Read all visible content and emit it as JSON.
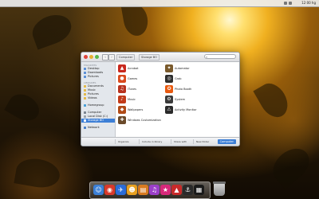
{
  "menubar": {
    "clock": "12:00 hg"
  },
  "window": {
    "nav": {
      "back": "‹",
      "forward": "›"
    },
    "breadcrumb": [
      "Computer",
      "Storage BO"
    ],
    "search": {
      "placeholder": "",
      "icon": "search-icon"
    }
  },
  "sidebar": {
    "sections": [
      {
        "heading": "Favorites",
        "items": [
          "Desktop",
          "Downloads",
          "Pictures"
        ]
      },
      {
        "heading": "Libraries",
        "items": [
          "Documents",
          "Music",
          "Pictures",
          "Videos"
        ]
      },
      {
        "heading": "",
        "items": [
          "Homegroup"
        ]
      },
      {
        "heading": "",
        "items": [
          "Computer",
          "Local Disk (C:)",
          "Storage BO"
        ]
      },
      {
        "heading": "",
        "items": [
          "Network"
        ]
      }
    ],
    "selected": "Storage BO"
  },
  "items": [
    {
      "label": "Acrobat",
      "color": "#c8281e",
      "glyph": "▲"
    },
    {
      "label": "Automator",
      "color": "#7a5a2c",
      "glyph": "✦"
    },
    {
      "label": "Games",
      "color": "#d94a1e",
      "glyph": "●"
    },
    {
      "label": "Grab",
      "color": "#2d2d2d",
      "glyph": "◎"
    },
    {
      "label": "iTunes",
      "color": "#b8321e",
      "glyph": "♫"
    },
    {
      "label": "Photo Booth",
      "color": "#e85a10",
      "glyph": "✪"
    },
    {
      "label": "Music",
      "color": "#c23a18",
      "glyph": "♪"
    },
    {
      "label": "System",
      "color": "#3a3a3a",
      "glyph": "⚙"
    },
    {
      "label": "Wallpapers",
      "color": "#b04a16",
      "glyph": "◆"
    },
    {
      "label": "Activity Monitor",
      "color": "#2a2a2a",
      "glyph": "⚠"
    },
    {
      "label": "Windows Customization",
      "color": "#6a4a2a",
      "glyph": "✚"
    }
  ],
  "bottombar": {
    "buttons": [
      "Organize",
      "Include in library",
      "Share with",
      "New folder"
    ],
    "selected_label": "Computer"
  },
  "dock": {
    "icons": [
      {
        "name": "finder-icon",
        "color": "#3b7fd6",
        "glyph": "☺"
      },
      {
        "name": "chrome-icon",
        "color": "#d8392b",
        "glyph": "◉"
      },
      {
        "name": "maps-icon",
        "color": "#2b6cd8",
        "glyph": "✈"
      },
      {
        "name": "smiley-icon",
        "color": "#e8a020",
        "glyph": "☻"
      },
      {
        "name": "clipboard-icon",
        "color": "#d87a20",
        "glyph": "▤"
      },
      {
        "name": "itunes-icon",
        "color": "#9b3fc8",
        "glyph": "♫"
      },
      {
        "name": "game-icon",
        "color": "#d8287a",
        "glyph": "★"
      },
      {
        "name": "pdf-icon",
        "color": "#c82a2a",
        "glyph": "▲"
      },
      {
        "name": "keychain-icon",
        "color": "#2a2a2a",
        "glyph": "⚓"
      },
      {
        "name": "photo-icon",
        "color": "#1a1a1a",
        "glyph": "▦"
      }
    ]
  }
}
